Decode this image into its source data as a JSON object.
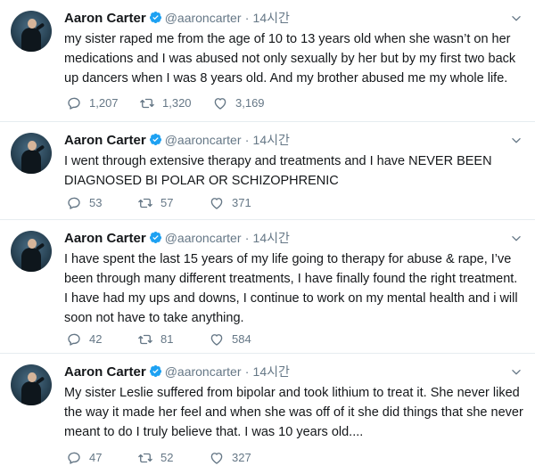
{
  "tweets": [
    {
      "author": "Aaron Carter",
      "handle": "@aaroncarter",
      "dot": "·",
      "time": "14시간",
      "text": "my sister raped me from the age of 10 to 13 years old when she wasn’t on her medications and I was abused not only sexually by her but by my first two back up dancers when I was 8 years old. And my brother abused me my whole life.",
      "replies": "1,207",
      "retweets": "1,320",
      "likes": "3,169"
    },
    {
      "author": "Aaron Carter",
      "handle": "@aaroncarter",
      "dot": "·",
      "time": "14시간",
      "text": "I went through extensive therapy and treatments and I have NEVER BEEN DIAGNOSED BI POLAR OR SCHIZOPHRENIC",
      "replies": "53",
      "retweets": "57",
      "likes": "371"
    },
    {
      "author": "Aaron Carter",
      "handle": "@aaroncarter",
      "dot": "·",
      "time": "14시간",
      "text": "I have spent the last 15 years of my life going to therapy for abuse & rape, I’ve been through many different treatments, I have finally found the right treatment. I have had my ups and downs, I continue to work on my mental health and i will soon not have to take anything.",
      "replies": "42",
      "retweets": "81",
      "likes": "584"
    },
    {
      "author": "Aaron Carter",
      "handle": "@aaroncarter",
      "dot": "·",
      "time": "14시간",
      "text": "My sister Leslie suffered from bipolar and took lithium to treat it. She never liked the way it made her feel and when she was off of it she did things that she never meant to do I truly believe that. I was 10 years old....",
      "replies": "47",
      "retweets": "52",
      "likes": "327"
    }
  ],
  "icons": {
    "reply": "reply-icon",
    "retweet": "retweet-icon",
    "like": "like-icon",
    "verified": "verified-badge-icon",
    "caret": "chevron-down-icon"
  },
  "colors": {
    "name": "#14171a",
    "secondary": "#657786",
    "verified": "#1da1f2",
    "divider": "#e6ecf0"
  }
}
